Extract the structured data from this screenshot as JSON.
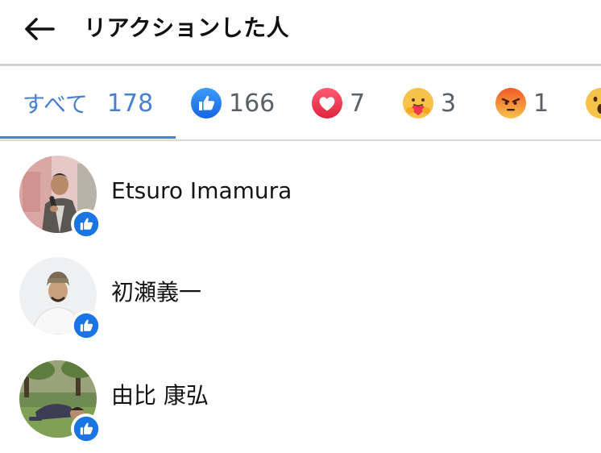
{
  "header": {
    "title": "リアクションした人",
    "back_icon": "arrow-left-icon"
  },
  "tabs": [
    {
      "label": "すべて",
      "count": "178"
    },
    {
      "icon": "like-icon",
      "count": "166"
    },
    {
      "icon": "love-icon",
      "count": "7"
    },
    {
      "icon": "care-icon",
      "count": "3"
    },
    {
      "icon": "angry-icon",
      "count": "1"
    },
    {
      "icon": "wow-icon"
    }
  ],
  "people": [
    {
      "name": "Etsuro Imamura",
      "reaction": "like-icon"
    },
    {
      "name": "初瀬義一",
      "reaction": "like-icon"
    },
    {
      "name": "由比 康弘",
      "reaction": "like-icon"
    }
  ],
  "colors": {
    "accent": "#4b7fd0",
    "like": "#1b74e4",
    "love": "#e0245e",
    "angry": "#f0652b"
  }
}
